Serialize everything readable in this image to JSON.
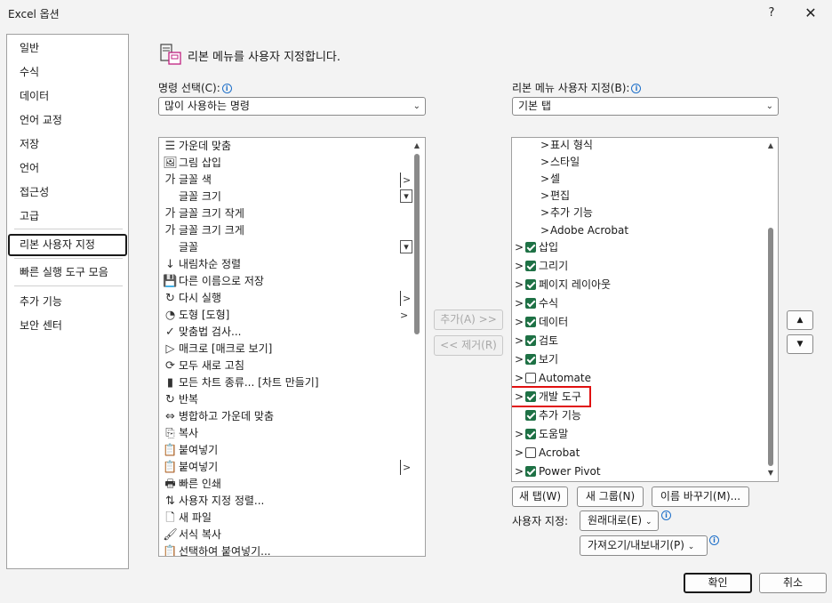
{
  "window": {
    "title": "Excel 옵션",
    "help": "?",
    "close": "✕"
  },
  "nav": {
    "items": [
      {
        "label": "일반"
      },
      {
        "label": "수식"
      },
      {
        "label": "데이터"
      },
      {
        "label": "언어 교정"
      },
      {
        "label": "저장"
      },
      {
        "label": "언어"
      },
      {
        "label": "접근성"
      },
      {
        "label": "고급"
      },
      {
        "label": "리본 사용자 지정",
        "selected": true
      },
      {
        "label": "빠른 실행 도구 모음"
      },
      {
        "label": "추가 기능"
      },
      {
        "label": "보안 센터"
      }
    ]
  },
  "header": {
    "text": "리본 메뉴를 사용자 지정합니다."
  },
  "left": {
    "label": "명령 선택(C):",
    "dropdown_value": "많이 사용하는 명령",
    "commands": [
      {
        "label": "가운데 맞춤",
        "icon": "☰"
      },
      {
        "label": "그림 삽입",
        "icon": "🖼"
      },
      {
        "label": "글꼴 색",
        "icon": "가",
        "right": "|>"
      },
      {
        "label": "글꼴 크기",
        "icon": "",
        "right": "I▾"
      },
      {
        "label": "글꼴 크기 작게",
        "icon": "가"
      },
      {
        "label": "글꼴 크기 크게",
        "icon": "가"
      },
      {
        "label": "글꼴",
        "icon": "",
        "right": "I▾"
      },
      {
        "label": "내림차순 정렬",
        "icon": "↓"
      },
      {
        "label": "다른 이름으로 저장",
        "icon": "💾"
      },
      {
        "label": "다시 실행",
        "icon": "↻",
        "right": "|>"
      },
      {
        "label": "도형 [도형]",
        "icon": "◔",
        "right": ">"
      },
      {
        "label": "맞춤법 검사...",
        "icon": "✓"
      },
      {
        "label": "매크로 [매크로 보기]",
        "icon": "▷"
      },
      {
        "label": "모두 새로 고침",
        "icon": "⟳"
      },
      {
        "label": "모든 차트 종류... [차트 만들기]",
        "icon": "▮"
      },
      {
        "label": "반복",
        "icon": "↻"
      },
      {
        "label": "병합하고 가운데 맞춤",
        "icon": "⇔"
      },
      {
        "label": "복사",
        "icon": "⎘"
      },
      {
        "label": "붙여넣기",
        "icon": "📋"
      },
      {
        "label": "붙여넣기",
        "icon": "📋",
        "right": "|>"
      },
      {
        "label": "빠른 인쇄",
        "icon": "🖶"
      },
      {
        "label": "사용자 지정 정렬...",
        "icon": "⇅"
      },
      {
        "label": "새 파일",
        "icon": "🗋"
      },
      {
        "label": "서식 복사",
        "icon": "🖌"
      },
      {
        "label": "선택하여 붙여넣기...",
        "icon": "📋"
      }
    ]
  },
  "middle": {
    "add": "추가(A) >>",
    "remove": "<< 제거(R)"
  },
  "right": {
    "label": "리본 메뉴 사용자 지정(B):",
    "dropdown_value": "기본 탭",
    "tree": [
      {
        "label": "표시 형식",
        "level": 1
      },
      {
        "label": "스타일",
        "level": 1
      },
      {
        "label": "셀",
        "level": 1
      },
      {
        "label": "편집",
        "level": 1
      },
      {
        "label": "추가 기능",
        "level": 1
      },
      {
        "label": "Adobe Acrobat",
        "level": 1
      },
      {
        "label": "삽입",
        "level": 0,
        "checked": true
      },
      {
        "label": "그리기",
        "level": 0,
        "checked": true
      },
      {
        "label": "페이지 레이아웃",
        "level": 0,
        "checked": true
      },
      {
        "label": "수식",
        "level": 0,
        "checked": true
      },
      {
        "label": "데이터",
        "level": 0,
        "checked": true
      },
      {
        "label": "검토",
        "level": 0,
        "checked": true
      },
      {
        "label": "보기",
        "level": 0,
        "checked": true
      },
      {
        "label": "Automate",
        "level": 0,
        "checked": false
      },
      {
        "label": "개발 도구",
        "level": 0,
        "checked": true,
        "highlight": true
      },
      {
        "label": "추가 기능",
        "level": 0,
        "checked": true,
        "no_chevron": true
      },
      {
        "label": "도움말",
        "level": 0,
        "checked": true
      },
      {
        "label": "Acrobat",
        "level": 0,
        "checked": false
      },
      {
        "label": "Power Pivot",
        "level": 0,
        "checked": true
      }
    ],
    "new_tab": "새 탭(W)",
    "new_group": "새 그룹(N)",
    "rename": "이름 바꾸기(M)...",
    "customize_label": "사용자 지정:",
    "reset": "원래대로(E)",
    "import_export": "가져오기/내보내기(P)"
  },
  "footer": {
    "ok": "확인",
    "cancel": "취소"
  }
}
